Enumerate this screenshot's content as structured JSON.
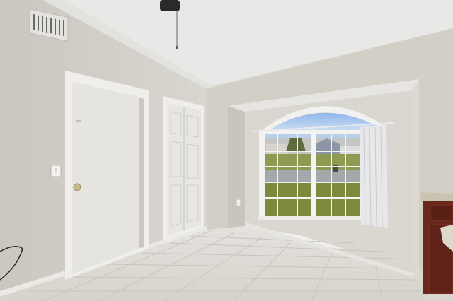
{
  "scene": {
    "colors": {
      "ceiling": "#e9e9e7",
      "wall_left": "#d3d1c9",
      "wall_back": "#cfccc4",
      "alcove_back": "#d8d6cf",
      "door": "#e6e5e1",
      "trim": "#eeede9",
      "floor": "#dedcd6",
      "grout": "#c5c2bb",
      "sky": "#a9c6ee",
      "lawn": "#7f8a3a",
      "road": "#9aa0a4",
      "cabinet": "#6b2a1d",
      "counter": "#cfc7b6",
      "curtain": "#e8e9ea"
    }
  }
}
